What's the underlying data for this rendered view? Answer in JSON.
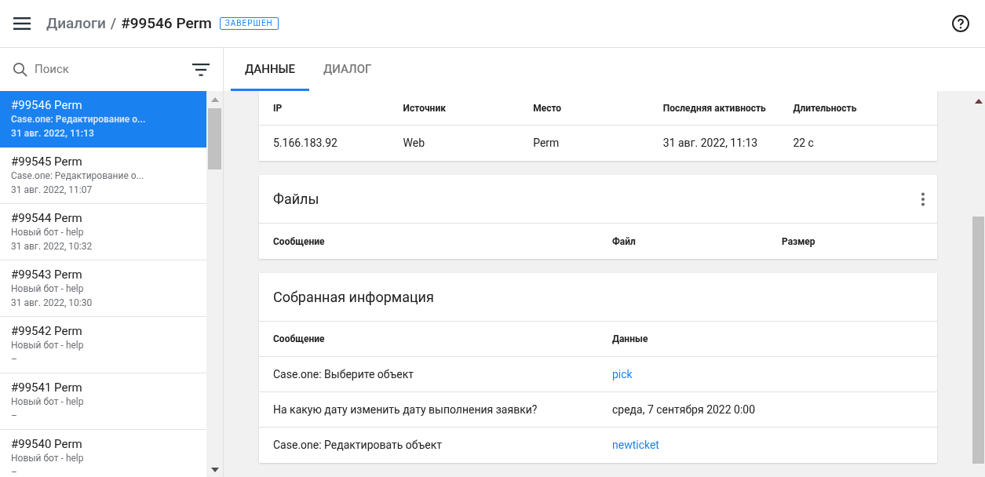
{
  "header": {
    "breadcrumb_parent": "Диалоги",
    "separator": "/",
    "title": "#99546 Perm",
    "status_badge": "ЗАВЕРШЕН"
  },
  "search": {
    "placeholder": "Поиск"
  },
  "dialogs": [
    {
      "title": "#99546 Perm",
      "subtitle": "Case.one: Редактирование о...",
      "time": "31 авг. 2022, 11:13",
      "selected": true
    },
    {
      "title": "#99545 Perm",
      "subtitle": "Case.one: Редактирование о...",
      "time": "31 авг. 2022, 11:07",
      "selected": false
    },
    {
      "title": "#99544 Perm",
      "subtitle": "Новый бот - help",
      "time": "31 авг. 2022, 10:32",
      "selected": false
    },
    {
      "title": "#99543 Perm",
      "subtitle": "Новый бот - help",
      "time": "31 авг. 2022, 10:30",
      "selected": false
    },
    {
      "title": "#99542 Perm",
      "subtitle": "Новый бот - help",
      "time": "–",
      "selected": false
    },
    {
      "title": "#99541 Perm",
      "subtitle": "Новый бот - help",
      "time": "–",
      "selected": false
    },
    {
      "title": "#99540 Perm",
      "subtitle": "Новый бот - help",
      "time": "–",
      "selected": false
    }
  ],
  "tabs": [
    {
      "label": "ДАННЫЕ",
      "selected": true
    },
    {
      "label": "ДИАЛОГ",
      "selected": false
    }
  ],
  "session_table": {
    "columns": [
      "IP",
      "Источник",
      "Место",
      "Последняя активность",
      "Длительность"
    ],
    "rows": [
      [
        "5.166.183.92",
        "Web",
        "Perm",
        "31 авг. 2022, 11:13",
        "22 с"
      ]
    ]
  },
  "files_card": {
    "title": "Файлы",
    "columns": [
      "Сообщение",
      "Файл",
      "Размер"
    ]
  },
  "collected_card": {
    "title": "Собранная информация",
    "columns": [
      "Сообщение",
      "Данные"
    ],
    "rows": [
      {
        "message": "Case.one: Выберите объект",
        "value": "pick",
        "kind": "link"
      },
      {
        "message": "На какую дату изменить дату выполнения заявки?",
        "value": "среда, 7 сентября 2022 0:00",
        "kind": "text"
      },
      {
        "message": "Case.one: Редактировать объект",
        "value": "newticket",
        "kind": "link"
      }
    ]
  }
}
